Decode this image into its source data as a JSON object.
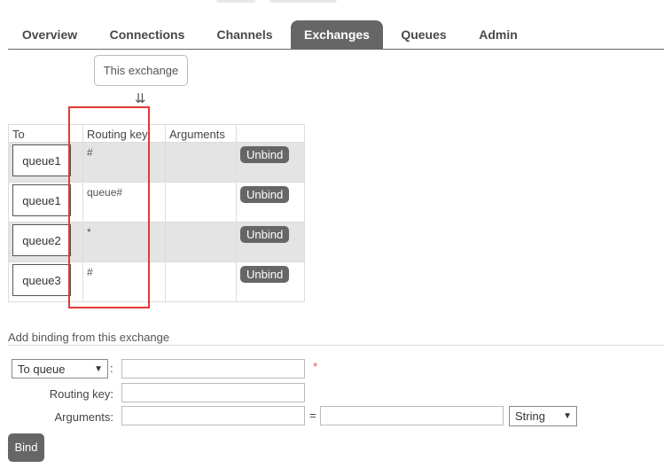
{
  "tabs": [
    {
      "label": "Overview"
    },
    {
      "label": "Connections"
    },
    {
      "label": "Channels"
    },
    {
      "label": "Exchanges",
      "active": true
    },
    {
      "label": "Queues"
    },
    {
      "label": "Admin"
    }
  ],
  "this_exchange_label": "This exchange",
  "arrows_glyph": "⇊",
  "bindings_table": {
    "headers": {
      "to": "To",
      "routing_key": "Routing key",
      "arguments": "Arguments"
    },
    "rows": [
      {
        "to": "queue1",
        "routing_key": "#",
        "arguments": "",
        "action": "Unbind"
      },
      {
        "to": "queue1",
        "routing_key": "queue#",
        "arguments": "",
        "action": "Unbind"
      },
      {
        "to": "queue2",
        "routing_key": "*",
        "arguments": "",
        "action": "Unbind"
      },
      {
        "to": "queue3",
        "routing_key": "#",
        "arguments": "",
        "action": "Unbind"
      }
    ]
  },
  "add_binding": {
    "title": "Add binding from this exchange",
    "destination_type": "To queue",
    "colon": ":",
    "required_marker": "*",
    "routing_key_label": "Routing key:",
    "arguments_label": "Arguments:",
    "equals": "=",
    "arg_type": "String",
    "bind_label": "Bind"
  },
  "colors": {
    "accent": "#666666",
    "highlight": "#e53935",
    "required": "#e05050"
  }
}
